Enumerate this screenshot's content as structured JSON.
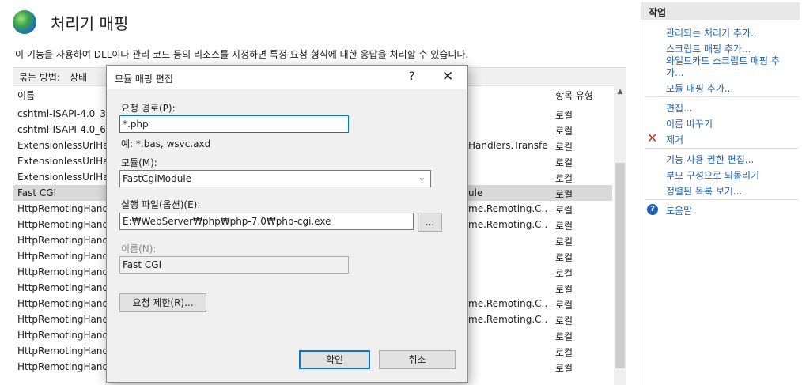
{
  "header": {
    "icon": "globe-icon",
    "title": "처리기 매핑",
    "description": "이 기능을 사용하여 DLL이나 관리 코드 등의 리소스를 지정하면 특정 요청 형식에 대한 응답을 처리할 수 있습니다."
  },
  "groupby": {
    "label": "묶는 방법:",
    "value": "상태"
  },
  "list": {
    "col_name": "이름",
    "col_type": "항목 유형",
    "rows": [
      {
        "name": "cshtml-ISAPI-4.0_32bit",
        "mid": "",
        "type": "로컬"
      },
      {
        "name": "cshtml-ISAPI-4.0_64bit",
        "mid": "",
        "type": "로컬"
      },
      {
        "name": "ExtensionlessUrlHandler",
        "mid": "Handlers.Transfe...",
        "type": "로컬"
      },
      {
        "name": "ExtensionlessUrlHandler",
        "mid": "",
        "type": "로컬"
      },
      {
        "name": "ExtensionlessUrlHandler",
        "mid": "",
        "type": "로컬"
      },
      {
        "name": "Fast CGI",
        "mid": "ule",
        "type": "로컬"
      },
      {
        "name": "HttpRemotingHandlerFactory",
        "mid": "me.Remoting.C...",
        "type": "로컬"
      },
      {
        "name": "HttpRemotingHandlerFactory",
        "mid": "me.Remoting.C...",
        "type": "로컬"
      },
      {
        "name": "HttpRemotingHandlerFactory",
        "mid": "",
        "type": "로컬"
      },
      {
        "name": "HttpRemotingHandlerFactory",
        "mid": "",
        "type": "로컬"
      },
      {
        "name": "HttpRemotingHandlerFactory",
        "mid": "",
        "type": "로컬"
      },
      {
        "name": "HttpRemotingHandlerFactory",
        "mid": "",
        "type": "로컬"
      },
      {
        "name": "HttpRemotingHandlerFactory",
        "mid": "me.Remoting.C...",
        "type": "로컬"
      },
      {
        "name": "HttpRemotingHandlerFactory",
        "mid": "me.Remoting.C...",
        "type": "로컬"
      },
      {
        "name": "HttpRemotingHandlerFactory",
        "mid": "",
        "type": "로컬"
      },
      {
        "name": "HttpRemotingHandlerFactory",
        "mid": "",
        "type": "로컬"
      },
      {
        "name": "HttpRemotingHandlerFactory",
        "mid": "",
        "type": "로컬"
      }
    ]
  },
  "actions": {
    "title": "작업",
    "add_managed": "관리되는 처리기 추가...",
    "add_script": "스크립트 매핑 추가...",
    "add_wildcard": "와일드카드 스크립트 매핑 추가...",
    "add_module": "모듈 매핑 추가...",
    "edit": "편집...",
    "rename": "이름 바꾸기",
    "remove": "제거",
    "edit_permissions": "기능 사용 권한 편집...",
    "revert": "부모 구성으로 되돌리기",
    "view_ordered": "정렬된 목록 보기...",
    "help": "도움말",
    "remove_icon": "red-x-icon",
    "help_icon": "help-icon"
  },
  "dialog": {
    "title": "모듈 매핑 편집",
    "help_glyph": "?",
    "close_glyph": "✕",
    "request_path_label": "요청 경로(P):",
    "request_path_value": "*.php",
    "example_text": "예: *.bas, wsvc.axd",
    "module_label": "모듈(M):",
    "module_value": "FastCgiModule",
    "exe_label": "실행 파일(옵션)(E):",
    "exe_value": "E:₩WebServer₩php₩php-7.0₩php-cgi.exe",
    "browse_label": "...",
    "name_label": "이름(N):",
    "name_value": "Fast CGI",
    "restrictions_label": "요청 제한(R)...",
    "ok_label": "확인",
    "cancel_label": "취소"
  }
}
